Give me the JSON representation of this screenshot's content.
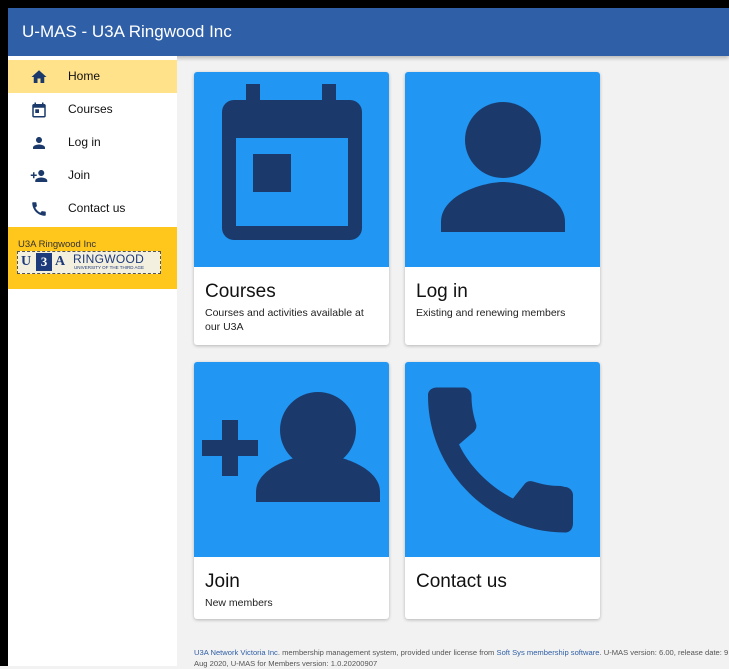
{
  "app": {
    "title": "U-MAS - U3A Ringwood Inc"
  },
  "nav": {
    "items": [
      {
        "label": "Home",
        "icon": "home-icon"
      },
      {
        "label": "Courses",
        "icon": "calendar-icon"
      },
      {
        "label": "Log in",
        "icon": "person-icon"
      },
      {
        "label": "Join",
        "icon": "person-add-icon"
      },
      {
        "label": "Contact us",
        "icon": "phone-icon"
      }
    ]
  },
  "org": {
    "name": "U3A Ringwood Inc",
    "logo": {
      "u": "U",
      "three": "3",
      "a": "A",
      "word": "RINGWOOD",
      "sub": "UNIVERSITY OF THE THIRD AGE"
    }
  },
  "cards": [
    {
      "title": "Courses",
      "description": "Courses and activities available at our U3A",
      "icon": "calendar-icon"
    },
    {
      "title": "Log in",
      "description": "Existing and renewing members",
      "icon": "person-icon"
    },
    {
      "title": "Join",
      "description": "New members",
      "icon": "person-add-icon"
    },
    {
      "title": "Contact us",
      "description": "",
      "icon": "phone-icon"
    }
  ],
  "footer": {
    "network_link": "U3A Network Victoria Inc",
    "text1": ". membership management system, provided under license from ",
    "vendor_link": "Soft Sys membership software",
    "text2": ". U-MAS version: 6.00, release date: 9 Aug 2020, U-MAS for Members version: 1.0.20200907"
  },
  "colors": {
    "appbar": "#2f5fa6",
    "card_media": "#2196f3",
    "icon": "#1b3a6b",
    "nav_active": "#ffe28a",
    "org_block": "#ffc61c"
  }
}
